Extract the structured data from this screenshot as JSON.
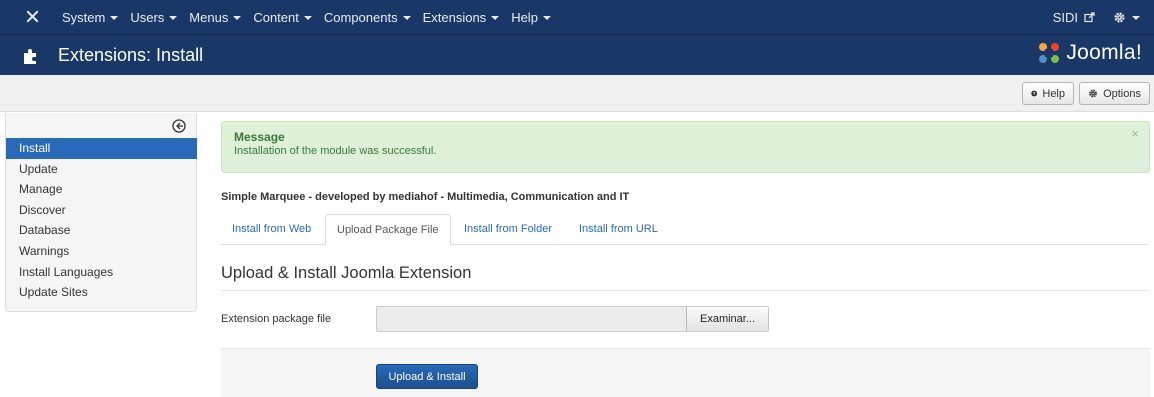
{
  "navbar": {
    "menus": [
      {
        "label": "System"
      },
      {
        "label": "Users"
      },
      {
        "label": "Menus"
      },
      {
        "label": "Content"
      },
      {
        "label": "Components"
      },
      {
        "label": "Extensions"
      },
      {
        "label": "Help"
      }
    ],
    "site_label": "SIDI"
  },
  "header": {
    "title": "Extensions: Install",
    "logo_text": "Joomla!"
  },
  "toolbar": {
    "help_label": "Help",
    "options_label": "Options"
  },
  "sidebar": {
    "items": [
      {
        "label": "Install",
        "active": true
      },
      {
        "label": "Update"
      },
      {
        "label": "Manage"
      },
      {
        "label": "Discover"
      },
      {
        "label": "Database"
      },
      {
        "label": "Warnings"
      },
      {
        "label": "Install Languages"
      },
      {
        "label": "Update Sites"
      }
    ]
  },
  "alert": {
    "title": "Message",
    "body": "Installation of the module was successful.",
    "close": "×"
  },
  "description": "Simple Marquee - developed by mediahof - Multimedia, Communication and IT",
  "tabs": [
    {
      "label": "Install from Web"
    },
    {
      "label": "Upload Package File",
      "active": true
    },
    {
      "label": "Install from Folder"
    },
    {
      "label": "Install from URL"
    }
  ],
  "section_title": "Upload & Install Joomla Extension",
  "form": {
    "file_label": "Extension package file",
    "browse_label": "Examinar...",
    "submit_label": "Upload & Install"
  },
  "colors": {
    "navbar": "#1a3867",
    "accent": "#2a69b8",
    "success_bg": "#dff0d8",
    "success_text": "#3c763d"
  }
}
